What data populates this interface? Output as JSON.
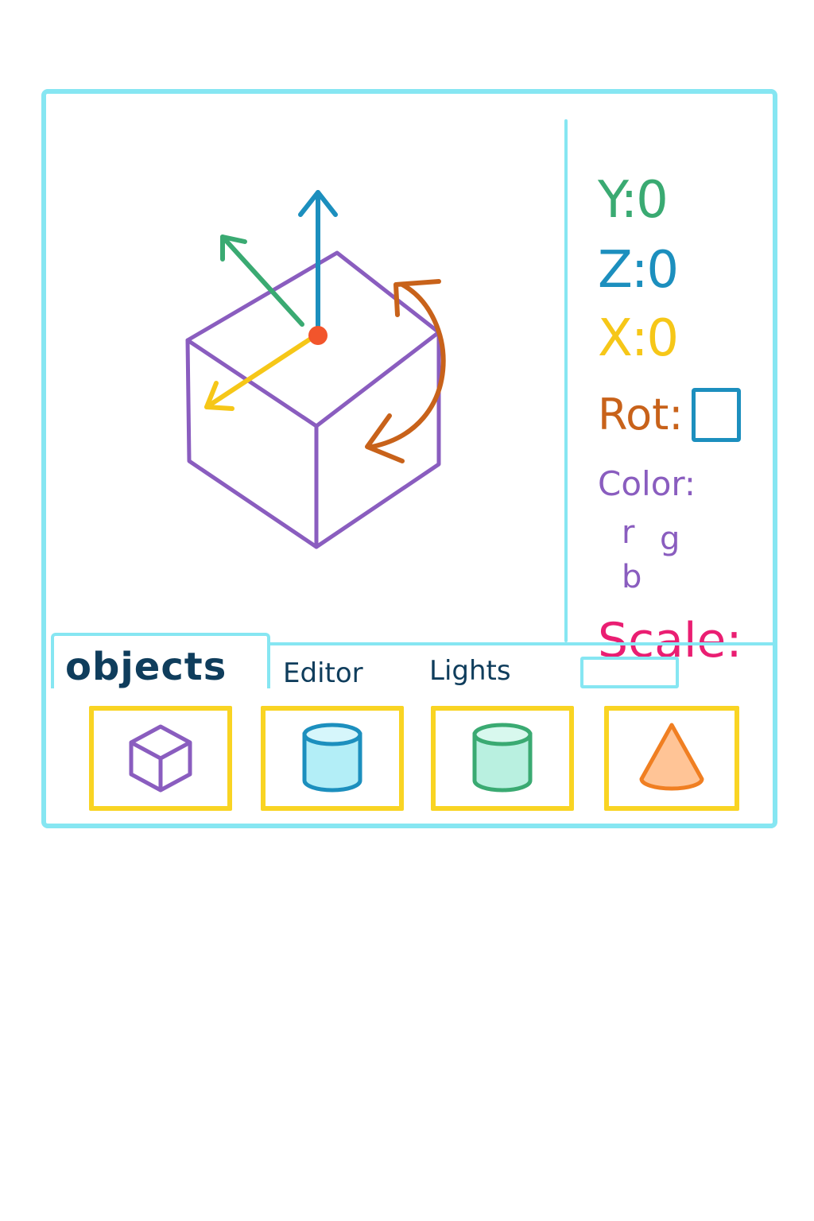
{
  "properties": {
    "y": "Y:0",
    "z": "Z:0",
    "x": "X:0",
    "rot": "Rot:",
    "color": "Color:",
    "color_channels": [
      "r",
      "g",
      "b"
    ],
    "scale": "Scale:"
  },
  "tabs": [
    {
      "label": "objects",
      "active": true
    },
    {
      "label": "Editor",
      "active": false
    },
    {
      "label": "Lights",
      "active": false
    }
  ],
  "library": [
    {
      "icon": "cube-icon"
    },
    {
      "icon": "cylinder-blue-icon"
    },
    {
      "icon": "cylinder-green-icon"
    },
    {
      "icon": "cone-icon"
    }
  ],
  "colors": {
    "frame": "#86e6f2",
    "cube": "#8a5dbf",
    "axis_y": "#1c8fbe",
    "axis_z": "#3aaa72",
    "axis_x": "#f6c718",
    "rotate": "#c8621a",
    "pivot": "#f2552c",
    "scale": "#ea1e72",
    "card_border": "#f9d423",
    "tab_text": "#0f3d5c"
  }
}
